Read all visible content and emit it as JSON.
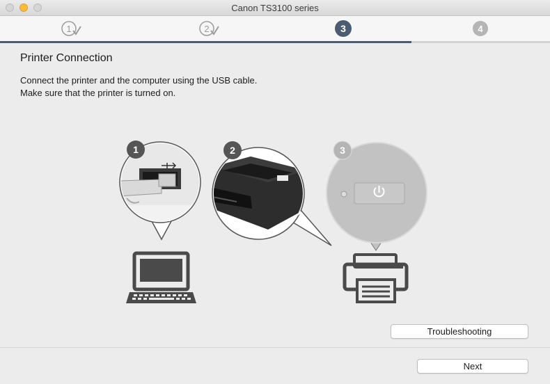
{
  "window": {
    "title": "Canon TS3100 series"
  },
  "steps": [
    {
      "label": "1",
      "state": "done"
    },
    {
      "label": "2",
      "state": "done"
    },
    {
      "label": "3",
      "state": "current"
    },
    {
      "label": "4",
      "state": "pending"
    }
  ],
  "page": {
    "heading": "Printer Connection",
    "instructions": [
      "Connect the printer and the computer using the USB cable.",
      "Make sure that the printer is turned on."
    ]
  },
  "illustration": {
    "callouts": [
      {
        "number": "1",
        "icon": "usb-port-icon"
      },
      {
        "number": "2",
        "icon": "printer-photo"
      },
      {
        "number": "3",
        "icon": "power-button-icon"
      }
    ],
    "devices": [
      "laptop-icon",
      "printer-icon"
    ]
  },
  "buttons": {
    "troubleshooting": "Troubleshooting",
    "next": "Next"
  },
  "colors": {
    "step_active": "#4b5c72",
    "step_pending": "#b5b5b5",
    "window_bg": "#ececec"
  }
}
